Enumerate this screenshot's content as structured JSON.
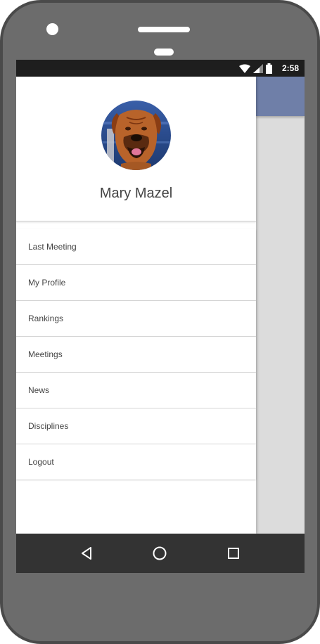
{
  "status_bar": {
    "time": "2:58",
    "icons": [
      "wifi-icon",
      "signal-icon",
      "battery-icon"
    ]
  },
  "drawer": {
    "user_name": "Mary Mazel",
    "avatar_icon": "dog-avatar",
    "menu_items": [
      {
        "label": "Last Meeting"
      },
      {
        "label": "My Profile"
      },
      {
        "label": "Rankings"
      },
      {
        "label": "Meetings"
      },
      {
        "label": "News"
      },
      {
        "label": "Disciplines"
      },
      {
        "label": "Logout"
      }
    ]
  },
  "navigation_bar": {
    "icons": [
      "back-icon",
      "home-icon",
      "recents-icon"
    ]
  },
  "colors": {
    "toolbar": "#6f7fa8",
    "status_bar": "#1e1e1e",
    "nav_bar": "#333333",
    "phone_body": "#6c6c6c"
  }
}
